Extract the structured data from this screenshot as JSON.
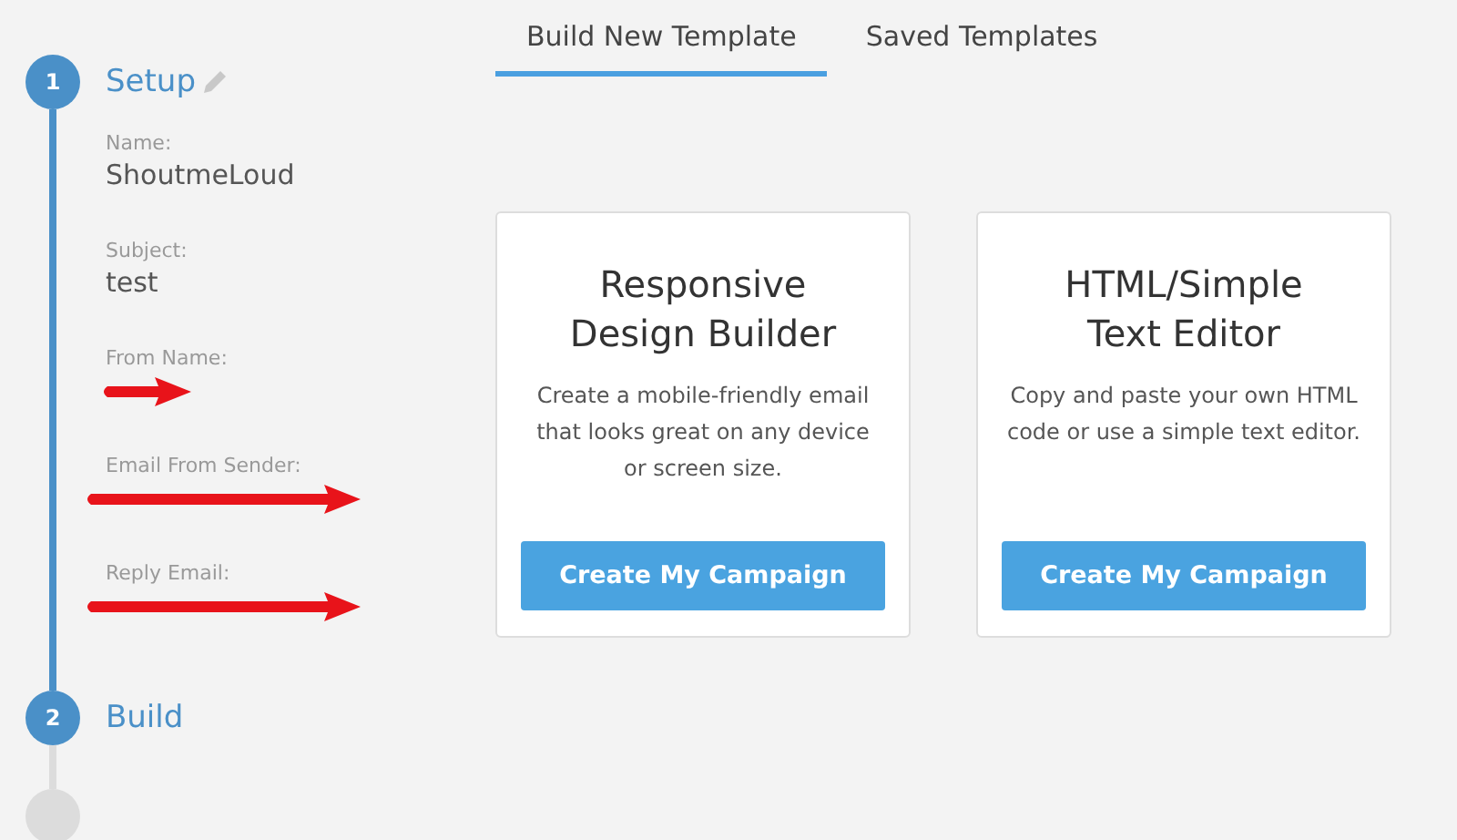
{
  "steps": [
    {
      "number": "1",
      "label": "Setup",
      "kind": "complete",
      "editable": true,
      "fields": [
        {
          "kind": "plain",
          "label": "Name:",
          "value": "ShoutmeLoud"
        },
        {
          "kind": "plain",
          "label": "Subject:",
          "value": "test"
        },
        {
          "kind": "pointer",
          "label": "From Name:"
        },
        {
          "kind": "strike",
          "label": "Email From Sender:"
        },
        {
          "kind": "strike",
          "label": "Reply Email:"
        }
      ]
    },
    {
      "number": "2",
      "label": "Build",
      "kind": "active"
    },
    {
      "kind": "pending"
    }
  ],
  "tabs": [
    {
      "label": "Build New Template",
      "selected": true
    },
    {
      "label": "Saved Templates",
      "selected": false
    }
  ],
  "cards": [
    {
      "title": "Responsive Design Builder",
      "description": "Create a mobile-friendly email that looks great on any device or screen size.",
      "button": "Create My Campaign"
    },
    {
      "title": "HTML/Simple Text Editor",
      "description": "Copy and paste your own HTML code or use a simple text editor.",
      "button": "Create My Campaign"
    }
  ]
}
